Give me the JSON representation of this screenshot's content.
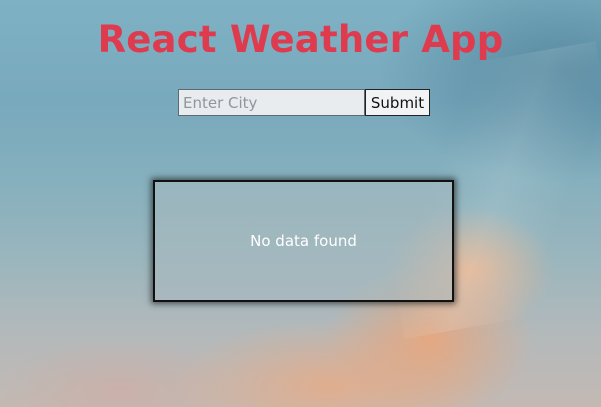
{
  "app": {
    "title": "React Weather App"
  },
  "search": {
    "value": "",
    "placeholder": "Enter City",
    "submit_label": "Submit"
  },
  "result": {
    "message": "No data found"
  },
  "colors": {
    "title": "#de3b4e",
    "sky": "#7fb1c4",
    "cloud": "#eca578"
  }
}
